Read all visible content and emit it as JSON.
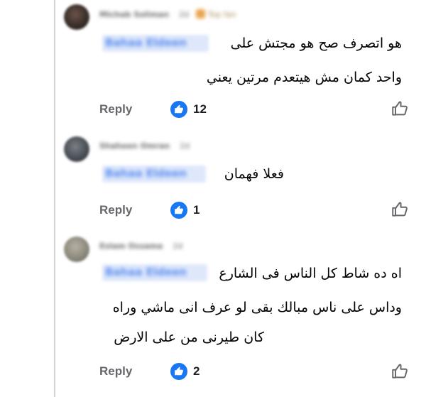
{
  "comments": [
    {
      "author": "Michab Soliman",
      "time": "2d",
      "badge": "Top fan",
      "mention": "Bahaa Eldeen",
      "lines": [
        "هو اتصرف صح هو مجتش على",
        "واحد كمان مش هيتعدم مرتين يعني"
      ],
      "reply_label": "Reply",
      "like_count": "12",
      "avatar_color": "#3a2e2a"
    },
    {
      "author": "Shaheen Omran",
      "time": "2d",
      "mention": "Bahaa Eldeen",
      "lines": [
        "فعلا فهمان"
      ],
      "reply_label": "Reply",
      "like_count": "1",
      "avatar_color": "#4a4f55"
    },
    {
      "author": "Eslam Ossama",
      "time": "2d",
      "mention": "Bahaa Eldeen",
      "lines": [
        "اه ده شاط كل الناس فى الشارع",
        "وداس على ناس مبالك بقى لو عرف انى ماشي وراه",
        "كان طيرنى من على الارض"
      ],
      "reply_label": "Reply",
      "like_count": "2",
      "avatar_color": "#8d8a7e"
    }
  ],
  "colors": {
    "accent": "#1877f2",
    "mention": "#5b8def",
    "secondary_text": "#65676b"
  },
  "icons": {
    "reaction": "thumbs-up-icon",
    "like_button": "thumbs-up-outline-icon"
  }
}
